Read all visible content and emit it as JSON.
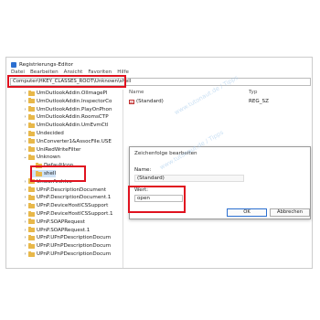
{
  "app": {
    "title": "Registrierungs-Editor"
  },
  "menu": [
    "Datei",
    "Bearbeiten",
    "Ansicht",
    "Favoriten",
    "Hilfe"
  ],
  "address": {
    "path": "Computer\\HKEY_CLASSES_ROOT\\Unknown\\shell"
  },
  "tree": {
    "items": [
      {
        "label": "UmOutlookAddin.OlImagePl",
        "indent": 2,
        "chev": "›"
      },
      {
        "label": "UmOutlookAddin.InspectorCo",
        "indent": 2,
        "chev": "›"
      },
      {
        "label": "UmOutlookAddin.PlayOnPhon",
        "indent": 2,
        "chev": "›"
      },
      {
        "label": "UmOutlookAddin.RoomsCTP",
        "indent": 2,
        "chev": "›"
      },
      {
        "label": "UmOutlookAddin.UmEvmCtl",
        "indent": 2,
        "chev": "›"
      },
      {
        "label": "Undecided",
        "indent": 2,
        "chev": "›"
      },
      {
        "label": "UnConverter1&AssocFile.USE",
        "indent": 2,
        "chev": "›"
      },
      {
        "label": "UniRedWriteFilter",
        "indent": 2,
        "chev": "›"
      },
      {
        "label": "Unknown",
        "indent": 2,
        "chev": "⌄"
      },
      {
        "label": "DefaultIcon",
        "indent": 3,
        "chev": ""
      },
      {
        "label": "shell",
        "indent": 3,
        "chev": "",
        "selected": true
      },
      {
        "label": "UnwarArchive",
        "indent": 2,
        "chev": "›"
      },
      {
        "label": "UPnP.DescriptionDocument",
        "indent": 2,
        "chev": "›"
      },
      {
        "label": "UPnP.DescriptionDocument.1",
        "indent": 2,
        "chev": "›"
      },
      {
        "label": "UPnP.DeviceHostICSSupport",
        "indent": 2,
        "chev": "›"
      },
      {
        "label": "UPnP.DeviceHostICSSupport.1",
        "indent": 2,
        "chev": "›"
      },
      {
        "label": "UPnP.SOAPRequest",
        "indent": 2,
        "chev": "›"
      },
      {
        "label": "UPnP.SOAPRequest.1",
        "indent": 2,
        "chev": "›"
      },
      {
        "label": "UPnP.UPnPDescriptionDocum",
        "indent": 2,
        "chev": "›"
      },
      {
        "label": "UPnP.UPnPDescriptionDocum",
        "indent": 2,
        "chev": "›"
      },
      {
        "label": "UPnP.UPnPDescriptionDocum",
        "indent": 2,
        "chev": "›"
      }
    ]
  },
  "values": {
    "headers": {
      "name": "Name",
      "type": "Typ"
    },
    "rows": [
      {
        "icon": "ab",
        "name": "(Standard)",
        "type": "REG_SZ"
      }
    ]
  },
  "dialog": {
    "title": "Zeichenfolge bearbeiten",
    "name_label": "Name:",
    "name_value": "(Standard)",
    "value_label": "Wert:",
    "value_value": "open",
    "ok_label": "OK",
    "cancel_label": "Abbrechen"
  },
  "colors": {
    "highlight": "#e0121f",
    "folder": "#e8b84a",
    "accent": "#2b6fd0"
  }
}
